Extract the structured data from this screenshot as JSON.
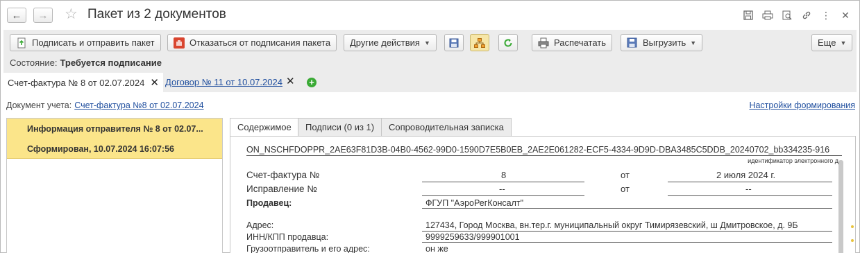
{
  "window": {
    "title": "Пакет из 2 документов"
  },
  "toolbar": {
    "sign_and_send": "Подписать и отправить пакет",
    "refuse_signing": "Отказаться от подписания пакета",
    "other_actions": "Другие действия",
    "print": "Распечатать",
    "export": "Выгрузить",
    "more": "Еще"
  },
  "state": {
    "label": "Состояние:",
    "value": "Требуется подписание"
  },
  "doc_tabs": [
    {
      "label": "Счет-фактура № 8 от 02.07.2024",
      "active": true
    },
    {
      "label": "Договор № 11 от 10.07.2024",
      "active": false
    }
  ],
  "doc_line": {
    "label": "Документ учета:",
    "link": "Счет-фактура №8 от 02.07.2024",
    "settings": "Настройки формирования"
  },
  "left_item": {
    "line1": "Информация отправителя № 8 от 02.07...",
    "line2": "Сформирован, 10.07.2024 16:07:56"
  },
  "content_tabs": [
    "Содержимое",
    "Подписи (0 из 1)",
    "Сопроводительная записка"
  ],
  "invoice": {
    "file_id": "ON_NSCHFDOPPR_2AE63F81D3B-04B0-4562-99D0-1590D7E5B0EB_2AE2E061282-ECF5-4334-9D9D-DBA3485C5DDB_20240702_bb334235-916",
    "file_id_label": "идентификатор электронного д",
    "invoice_no_label": "Счет-фактура №",
    "invoice_no": "8",
    "from_label": "от",
    "invoice_date": "2 июля 2024 г.",
    "correction_label": "Исправление №",
    "correction_no": "--",
    "correction_from_label": "от",
    "correction_date": "--",
    "seller_label": "Продавец:",
    "seller": "ФГУП \"АэроРегКонсалт\"",
    "address_label": "Адрес:",
    "address": "127434, Город Москва, вн.тер.г. муниципальный округ Тимирязевский, ш Дмитровское, д. 9Б",
    "inn_label": "ИНН/КПП продавца:",
    "inn": "9999259633/999901001",
    "shipper_label": "Грузоотправитель и его адрес:",
    "shipper": "он же"
  },
  "colors": {
    "selected_row": "#fbe58a",
    "link": "#1f4e9e",
    "toolbar_bg": "#ececec"
  }
}
